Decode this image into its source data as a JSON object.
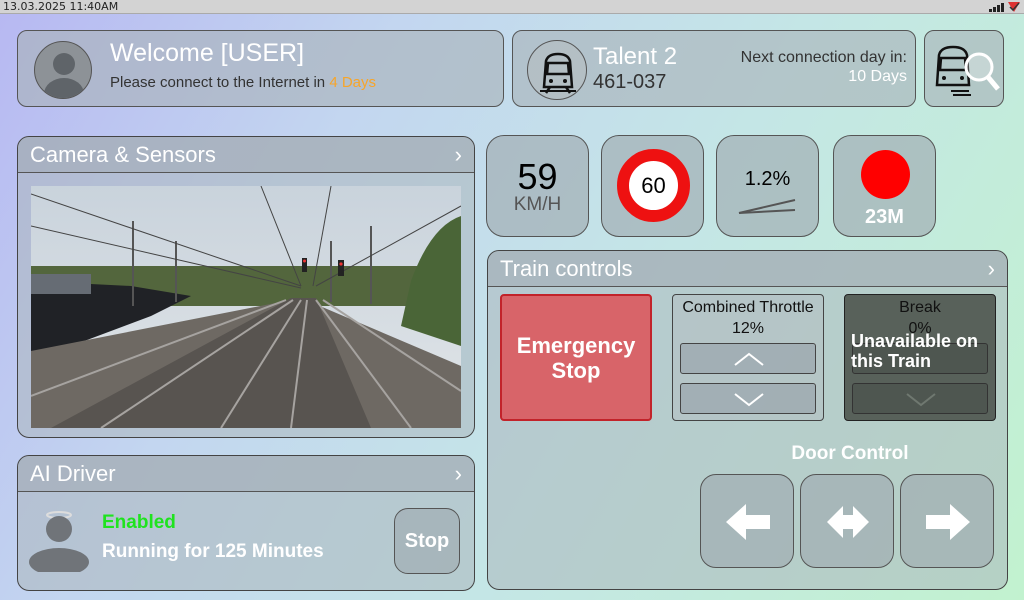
{
  "status": {
    "datetime": "13.03.2025 11:40AM",
    "icons": [
      "signal-icon",
      "wifi-icon"
    ]
  },
  "welcome": {
    "title": "Welcome [USER]",
    "message_prefix": "Please connect to the Internet in ",
    "message_days": "4 Days",
    "days_color": "#f7a52a"
  },
  "train": {
    "name": "Talent 2",
    "number": "461-037",
    "next_label": "Next connection day in:",
    "next_value": "10 Days"
  },
  "camera": {
    "title": "Camera & Sensors"
  },
  "ai_driver": {
    "title": "AI Driver",
    "status": "Enabled",
    "running": "Running for 125 Minutes",
    "stop_label": "Stop",
    "status_color": "#1fe31f"
  },
  "gauges": {
    "speed_value": "59",
    "speed_unit": "KM/H",
    "speed_limit": "60",
    "gradient": "1.2%",
    "signal_distance": "23M",
    "signal_color": "#ff0000"
  },
  "train_controls": {
    "title": "Train controls",
    "emergency_label": "Emergency Stop",
    "throttle_label": "Combined Throttle",
    "throttle_value": "12%",
    "brake_label": "Break",
    "brake_value": "0%",
    "brake_unavailable": "Unavailable on this Train",
    "door_label": "Door Control"
  }
}
